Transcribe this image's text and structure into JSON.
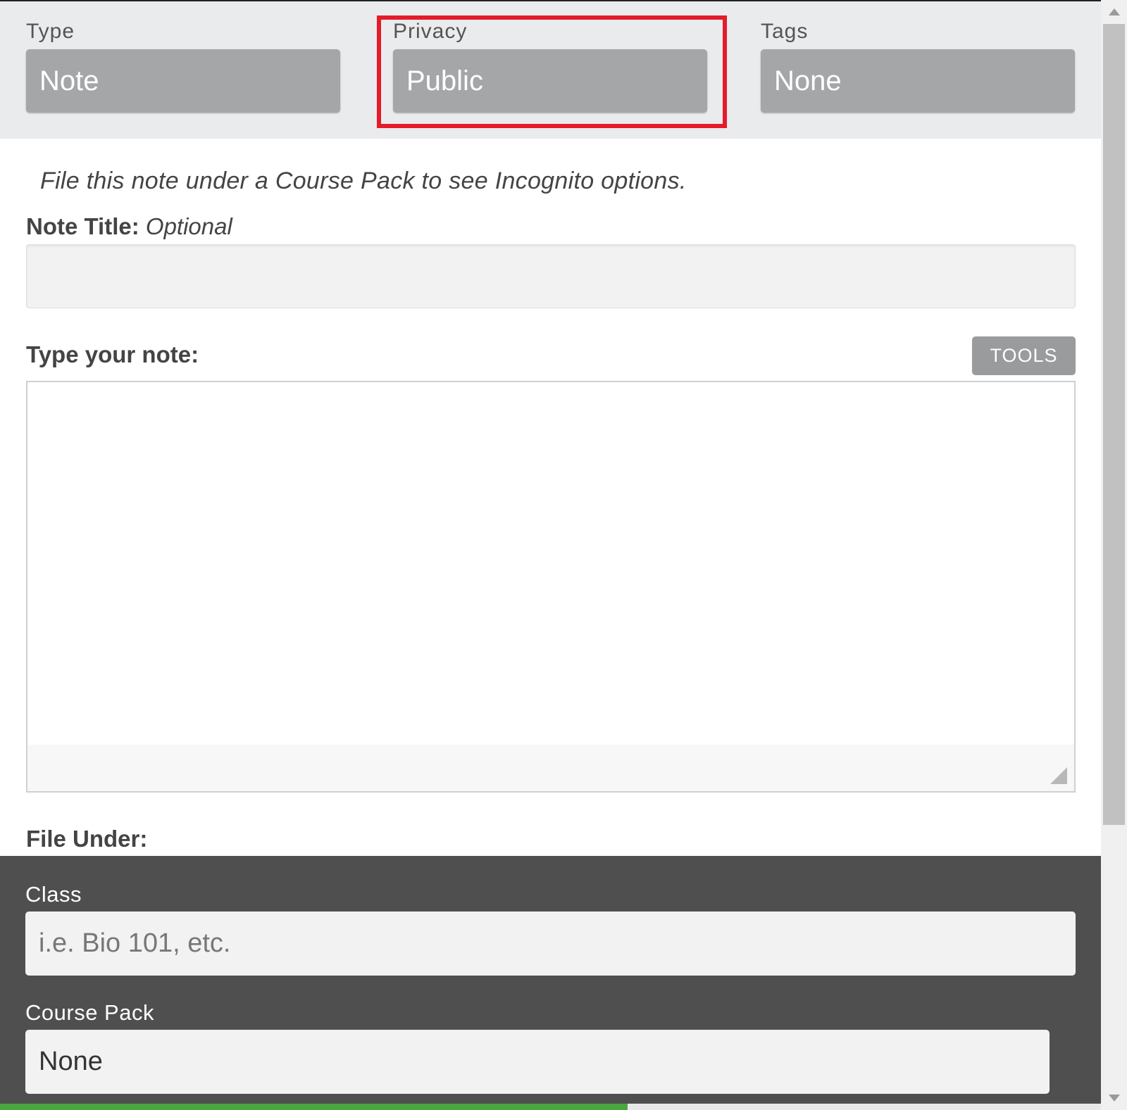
{
  "header": {
    "type_label": "Type",
    "type_value": "Note",
    "privacy_label": "Privacy",
    "privacy_value": "Public",
    "tags_label": "Tags",
    "tags_value": "None",
    "highlight_color": "#e41c2a"
  },
  "notice": "File this note under a Course Pack to see Incognito options.",
  "note_title": {
    "label": "Note Title:",
    "hint": "Optional",
    "value": ""
  },
  "note_body": {
    "label": "Type your note:",
    "tools_label": "TOOLS",
    "value": ""
  },
  "file_under": {
    "label": "File Under:",
    "class_label": "Class",
    "class_placeholder": "i.e. Bio 101, etc.",
    "course_pack_label": "Course Pack",
    "course_pack_value": "None"
  },
  "progress": {
    "fraction": 0.57,
    "color": "#4aa63f"
  }
}
